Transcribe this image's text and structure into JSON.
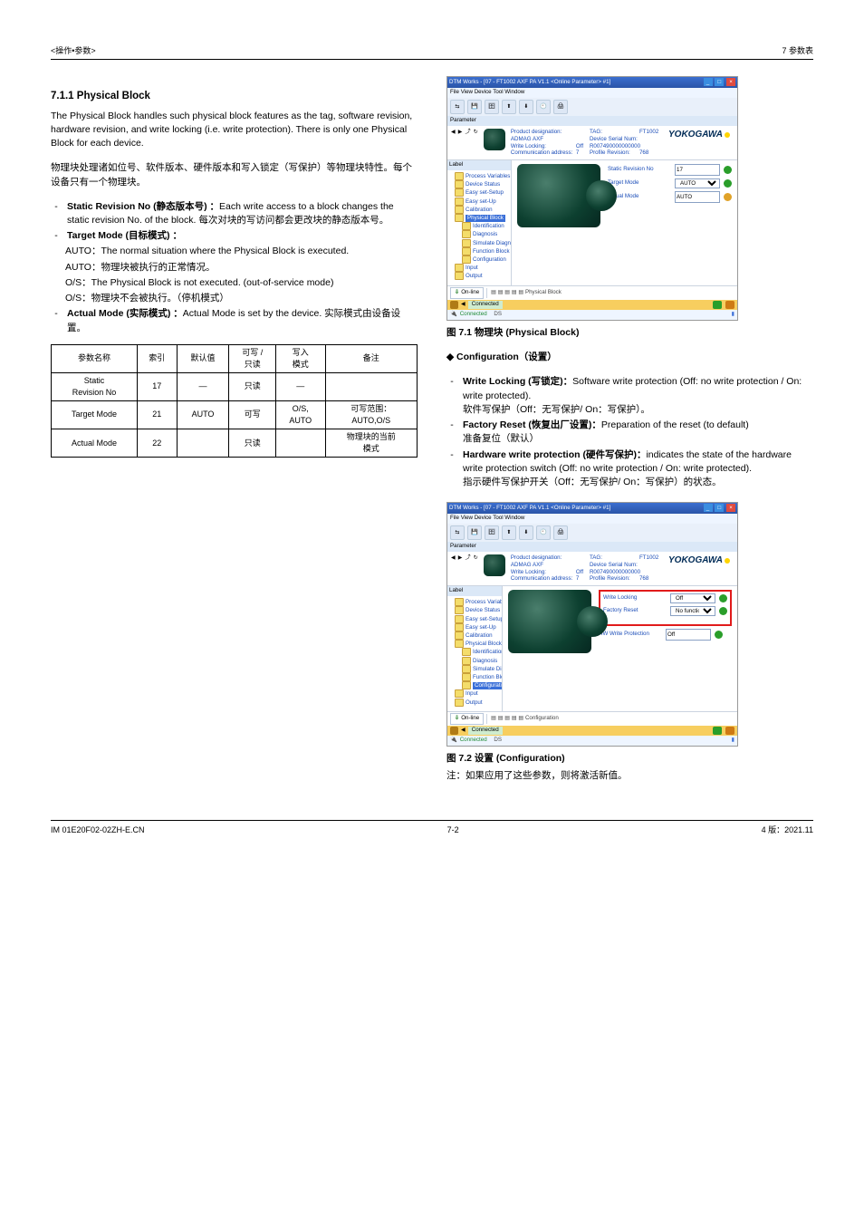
{
  "header": {
    "left": "<操作•参数>",
    "right": "7 参数表"
  },
  "sections": {
    "s711_title": "7.1.1 Physical Block",
    "s711_body_en": "The Physical Block handles such physical block features as the tag, software revision, hardware revision, and write locking (i.e. write protection). There is only one Physical Block for each device.",
    "s711_body_cn": "物理块处理诸如位号、软件版本、硬件版本和写入锁定（写保护）等物理块特性。每个设备只有一个物理块。",
    "bullets": [
      {
        "head": "Static Revision No (静态版本号) ：",
        "body": "Each write access to a block changes the static revision No. of the block. 每次对块的写访问都会更改块的静态版本号。"
      },
      {
        "head": "Target Mode (目标模式) ：",
        "body_en": "AUTO：The normal situation where the Physical Block is executed.",
        "body_cn": "AUTO：物理块被执行的正常情况。",
        "body2_en": "O/S：The Physical Block is not executed. (out-of-service mode)",
        "body2_cn": "O/S：物理块不会被执行。（停机模式）"
      },
      {
        "head": "Actual Mode (实际模式) ：",
        "body": "Actual Mode is set by the device. 实际模式由设备设置。"
      }
    ],
    "configuration_head": "◆ Configuration（设置）",
    "config_bullets": [
      {
        "head": "Write Locking (写锁定)：",
        "body_en": "Software write protection (Off: no write protection / On: write protected).",
        "body_cn": "软件写保护（Off：无写保护/ On：写保护）。"
      },
      {
        "head": "Factory Reset (恢复出厂设置)：",
        "body_en": "Preparation of the reset (to default)",
        "body_cn": "准备复位（默认）"
      },
      {
        "head": "Hardware write protection (硬件写保护)：",
        "body_en": "indicates the state of the hardware write protection switch (Off: no write protection / On: write protected).",
        "body_cn": "指示硬件写保护开关（Off：无写保护/ On：写保护）的状态。"
      }
    ]
  },
  "table": {
    "headers": [
      "参数名称",
      "索引",
      "默认值",
      "可写 /\n只读",
      "写入\n模式",
      "备注"
    ],
    "rows": [
      [
        "Static\nRevision No",
        "17",
        "―",
        "只读",
        "―",
        ""
      ],
      [
        "Target Mode",
        "21",
        "AUTO",
        "可写",
        "O/S,\nAUTO",
        "可写范围：\nAUTO,O/S"
      ],
      [
        "Actual Mode",
        "22",
        "",
        "只读",
        "",
        "物理块的当前\n模式"
      ]
    ]
  },
  "figs": {
    "f71": "图 7.1 物理块 (Physical Block)",
    "f72": "图 7.2 设置 (Configuration)",
    "note": "注：如果应用了这些参数，则将激活新值。"
  },
  "screenshot_common": {
    "title": "DTM Works - [07 - FT1002 AXF PA V1.1 <Online Parameter> #1]",
    "menus": "File   View   Device   Tool   Window",
    "paramlabel": "Parameter",
    "product_designation_k": "Product designation:",
    "product_designation_v": "ADMAG AXF",
    "write_locking_k": "Write Locking:",
    "write_locking_v": "Off",
    "comm_addr_k": "Communication address:",
    "comm_addr_v": "7",
    "tag_k": "TAG:",
    "tag_v": "FT1002",
    "serial_k": "Device Serial Num:",
    "serial_v": "R007490000000000",
    "profile_k": "Profile Revision:",
    "profile_v": "768",
    "brand": "YOKOGAWA",
    "tree_label": "Label",
    "tree": [
      "Process Variables",
      "Device Status",
      "Easy set-Setup",
      "Easy set-Up",
      "Calibration",
      "Physical Block",
      "Identification",
      "Diagnosis",
      "Simulate Diagnosis",
      "Function Block Status",
      "Configuration",
      "Input",
      "Output"
    ],
    "online_btn": "On-line",
    "status_connected": "Connected",
    "status_ds": "DS"
  },
  "shot1": {
    "tabstrip": "Physical Block",
    "rows": {
      "r1_label": "Static Revision No",
      "r1_val": "17",
      "r2_label": "Target Mode",
      "r2_val": "AUTO",
      "r3_label": "Actual Mode",
      "r3_val": "AUTO"
    },
    "connected_str": "Connected"
  },
  "shot2": {
    "tabstrip": "Configuration",
    "rows": {
      "r1_label": "Write Locking",
      "r1_val": "Off",
      "r2_label": "Factory Reset",
      "r2_val": "No function",
      "r3_label": "HW Write Protection",
      "r3_val": "Off"
    },
    "connected_str": "Connected"
  },
  "footer": {
    "left": "IM 01E20F02-02ZH-E.CN",
    "center": "7-2",
    "right": "4 版：2021.11"
  }
}
